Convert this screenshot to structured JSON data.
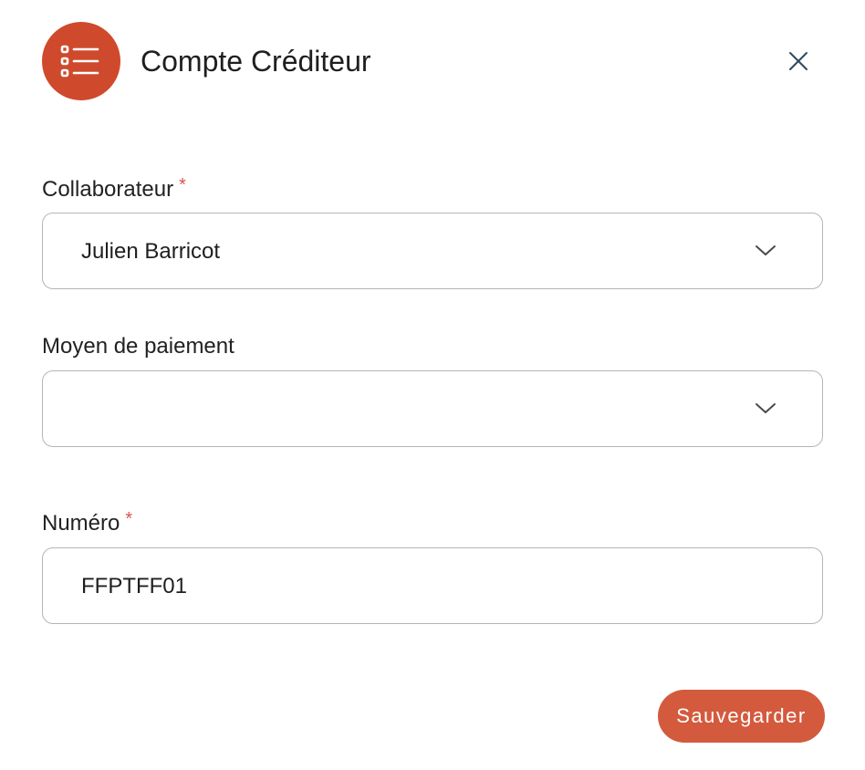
{
  "header": {
    "title": "Compte Créditeur",
    "icon": "list-icon",
    "close_icon": "close-icon",
    "accent_color": "#cf4a2c"
  },
  "form": {
    "collaborateur": {
      "label": "Collaborateur",
      "required_mark": "*",
      "value": "Julien Barricot"
    },
    "moyen_paiement": {
      "label": "Moyen de paiement",
      "value": ""
    },
    "numero": {
      "label": "Numéro",
      "required_mark": "*",
      "value": "FFPTFF01"
    }
  },
  "actions": {
    "save_label": "Sauvegarder",
    "save_color": "#d45a3e"
  }
}
